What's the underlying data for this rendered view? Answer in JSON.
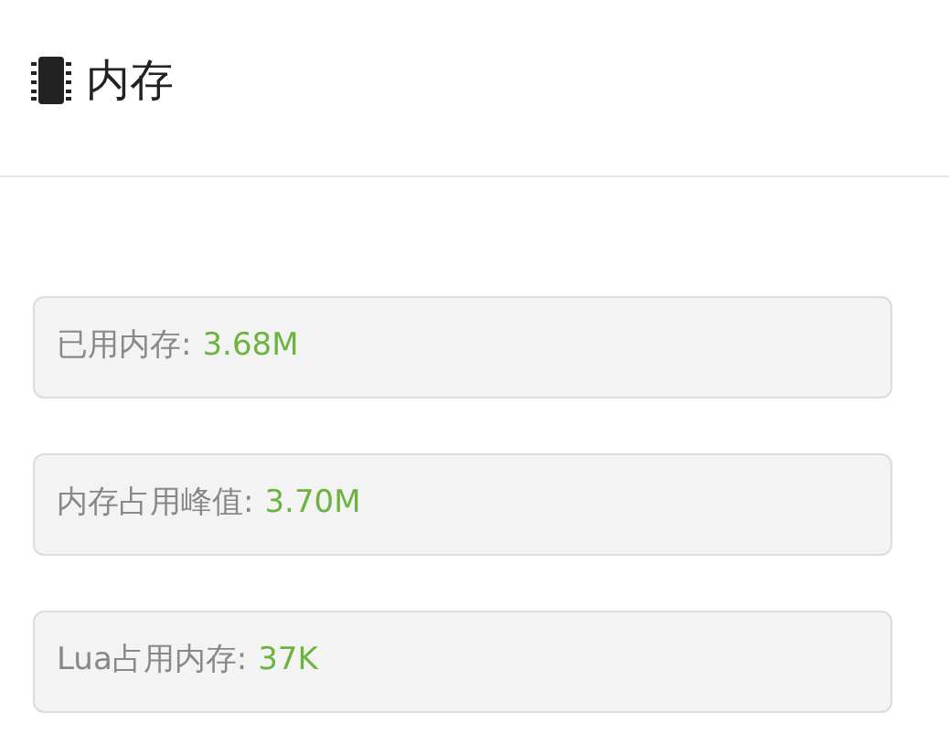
{
  "header": {
    "title": "内存"
  },
  "stats": [
    {
      "label": "已用内存:",
      "value": "3.68M"
    },
    {
      "label": "内存占用峰值:",
      "value": "3.70M"
    },
    {
      "label": "Lua占用内存:",
      "value": "37K"
    }
  ]
}
